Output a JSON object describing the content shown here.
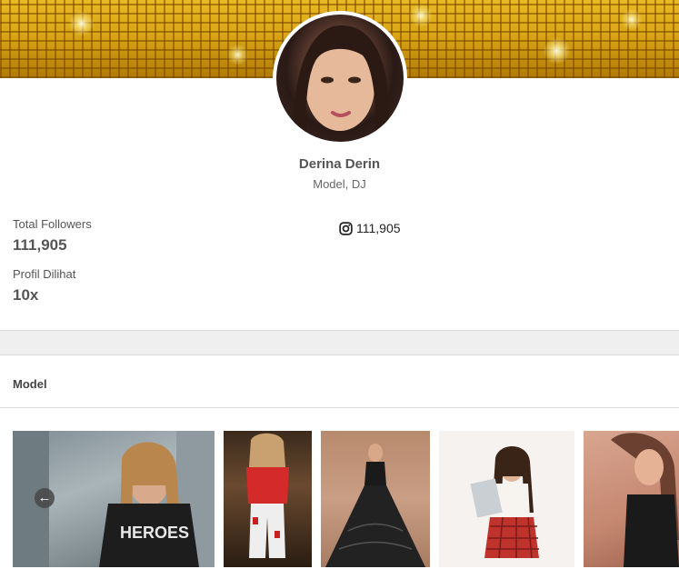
{
  "profile": {
    "name": "Derina Derin",
    "role": "Model, DJ"
  },
  "stats": {
    "followers_label": "Total Followers",
    "followers_value": "111,905",
    "views_label": "Profil Dilihat",
    "views_value": "10x"
  },
  "instagram": {
    "icon": "instagram-icon",
    "count": "111,905"
  },
  "section": {
    "title": "Model"
  },
  "gallery": {
    "prev_icon": "arrow-left-circle-icon",
    "photo_text": "HEROES"
  },
  "colors": {
    "banner_gold": "#d9a514",
    "text": "#555555",
    "divider": "#dcdcdc"
  }
}
